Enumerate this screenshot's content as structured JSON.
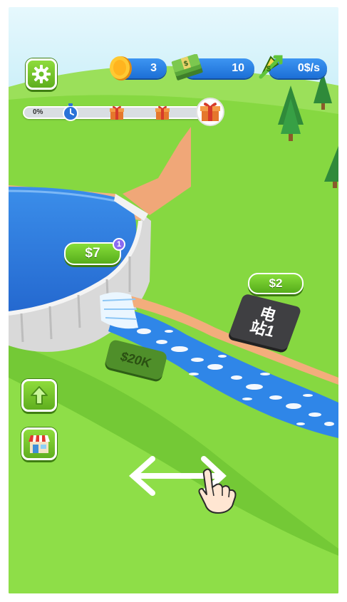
{
  "hud": {
    "coins": "3",
    "cash": "10",
    "rate": "0$/s"
  },
  "progress": {
    "percent_label": "0%",
    "value": 0,
    "milestones": [
      "timer-icon",
      "gift-box-icon",
      "gift-box-icon",
      "big-gift-box-icon"
    ]
  },
  "world": {
    "dam_price": "$7",
    "dam_badge": "1",
    "station_price": "$2",
    "station_sign_line1": "电",
    "station_sign_line2": "站1",
    "ground_value": "$20K"
  },
  "side_buttons": {
    "upgrade_icon": "up-arrow-icon",
    "shop_icon": "shop-icon"
  },
  "tutorial": {
    "gesture": "swipe-left-right-hand-icon"
  },
  "colors": {
    "sky": "#d3f2fb",
    "grass": "#7fd63a",
    "water": "#2f86e8",
    "cliff": "#f3ad7c",
    "button_green": "#6cc12a",
    "pill_blue": "#2a82e6"
  }
}
